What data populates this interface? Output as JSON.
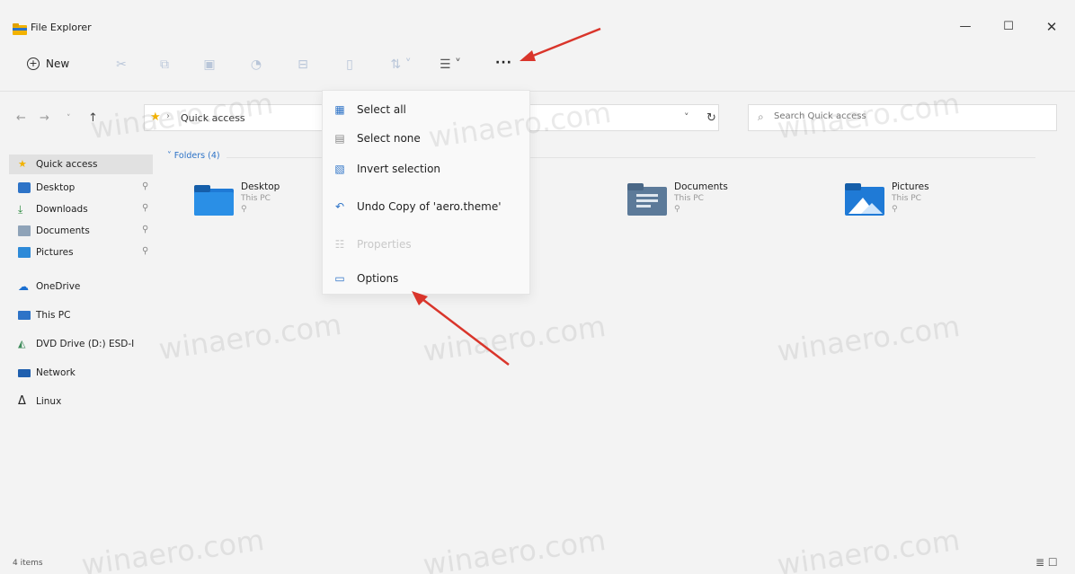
{
  "window": {
    "title": "File Explorer",
    "minimize": "—",
    "maximize": "☐",
    "close": "✕"
  },
  "toolbar": {
    "new_label": "New",
    "more_label": "···",
    "icons": [
      "cut-icon",
      "copy-icon",
      "paste-icon",
      "rename-icon",
      "share-icon",
      "delete-icon",
      "sort-icon",
      "view-icon"
    ]
  },
  "address": {
    "path": "Quick access",
    "search_placeholder": "Search Quick access"
  },
  "sidebar": {
    "items": [
      {
        "label": "Quick access",
        "icon": "star-icon",
        "selected": true
      },
      {
        "label": "Desktop",
        "icon": "desktop-icon",
        "pinned": true
      },
      {
        "label": "Downloads",
        "icon": "download-icon",
        "pinned": true
      },
      {
        "label": "Documents",
        "icon": "documents-icon",
        "pinned": true
      },
      {
        "label": "Pictures",
        "icon": "pictures-icon",
        "pinned": true
      },
      {
        "label": "OneDrive",
        "icon": "cloud-icon"
      },
      {
        "label": "This PC",
        "icon": "monitor-icon"
      },
      {
        "label": "DVD Drive (D:) ESD-I",
        "icon": "dvd-icon"
      },
      {
        "label": "Network",
        "icon": "network-icon"
      },
      {
        "label": "Linux",
        "icon": "linux-icon"
      }
    ]
  },
  "content": {
    "group_header": "Folders (4)",
    "folders": [
      {
        "name": "Desktop",
        "location": "This PC"
      },
      {
        "name": "Documents",
        "location": "This PC"
      },
      {
        "name": "Pictures",
        "location": "This PC"
      }
    ]
  },
  "menu": {
    "items": [
      {
        "label": "Select all",
        "icon": "select-all-icon",
        "disabled": false
      },
      {
        "label": "Select none",
        "icon": "select-none-icon",
        "disabled": false
      },
      {
        "label": "Invert selection",
        "icon": "invert-selection-icon",
        "disabled": false
      },
      {
        "label": "Undo Copy of 'aero.theme'",
        "icon": "undo-icon",
        "disabled": false
      },
      {
        "label": "Properties",
        "icon": "properties-icon",
        "disabled": true
      },
      {
        "label": "Options",
        "icon": "options-icon",
        "disabled": false
      }
    ]
  },
  "status": {
    "count": "4 items"
  },
  "watermark": "winaero.com",
  "colors": {
    "accent": "#2d73c7",
    "arrow": "#d9352b",
    "folder_yellow": "#f2b200"
  }
}
